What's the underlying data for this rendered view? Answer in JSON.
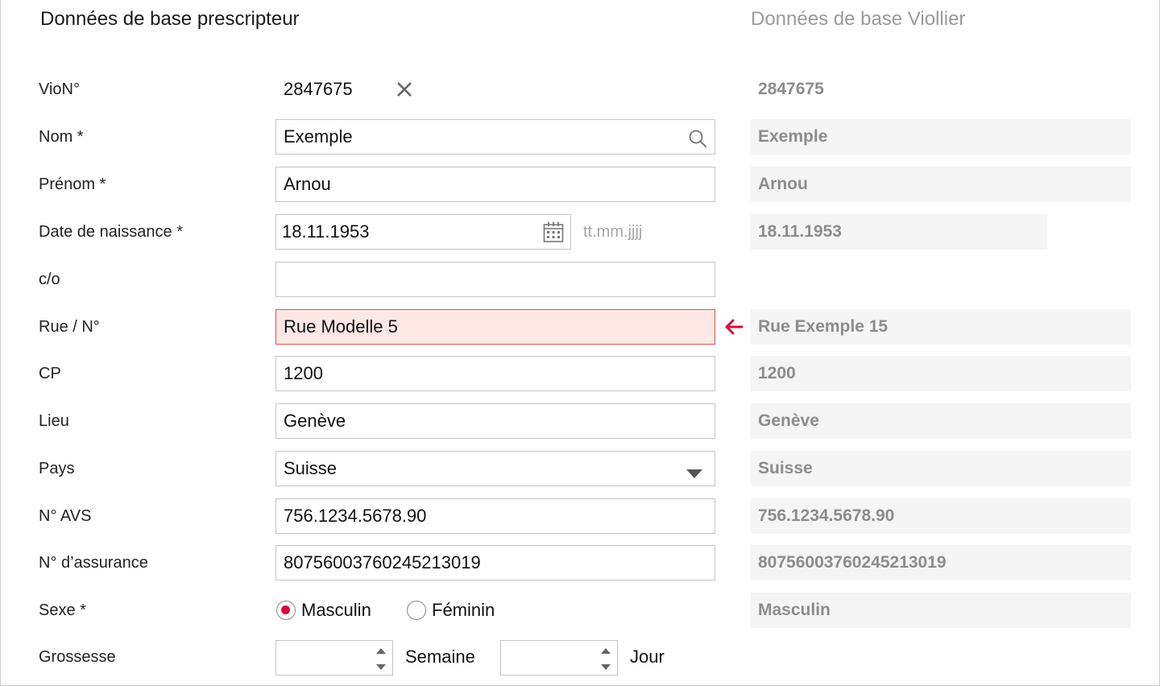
{
  "headers": {
    "left": "Données de base prescripteur",
    "right": "Données de base Viollier"
  },
  "rows": {
    "vion": {
      "label": "VioN°",
      "value": "2847675",
      "ref": "2847675"
    },
    "nom": {
      "label": "Nom *",
      "value": "Exemple",
      "ref": "Exemple"
    },
    "prenom": {
      "label": "Prénom *",
      "value": "Arnou",
      "ref": "Arnou"
    },
    "birth": {
      "label": "Date de naissance *",
      "value": "18.11.1953",
      "placeholder_hint": "tt.mm.jjjj",
      "ref": "18.11.1953"
    },
    "co": {
      "label": "c/o",
      "value": ""
    },
    "street": {
      "label": "Rue / N°",
      "value": "Rue Modelle 5",
      "ref": "Rue Exemple 15"
    },
    "cp": {
      "label": "CP",
      "value": "1200",
      "ref": "1200"
    },
    "city": {
      "label": "Lieu",
      "value": "Genève",
      "ref": "Genève"
    },
    "country": {
      "label": "Pays",
      "value": "Suisse",
      "ref": "Suisse"
    },
    "avs": {
      "label": "N° AVS",
      "value": "756.1234.5678.90",
      "ref": "756.1234.5678.90"
    },
    "insurance": {
      "label": "N° d’assurance",
      "value": "80756003760245213019",
      "ref": "80756003760245213019"
    },
    "sex": {
      "label": "Sexe *",
      "option_m": "Masculin",
      "option_f": "Féminin",
      "selected": "Masculin",
      "ref": "Masculin"
    },
    "pregnancy": {
      "label": "Grossesse",
      "week_label": "Semaine",
      "day_label": "Jour"
    }
  },
  "icons": {
    "clear": "close-icon",
    "search": "search-icon",
    "calendar": "calendar-icon",
    "dropdown": "chevron-down-icon",
    "arrow": "arrow-left-icon"
  },
  "colors": {
    "accent": "#d90a3e",
    "error_bg": "#fde8e5",
    "error_border": "#d9534f",
    "ref_bg": "#f5f5f5",
    "ref_text": "#8c8c8c"
  }
}
